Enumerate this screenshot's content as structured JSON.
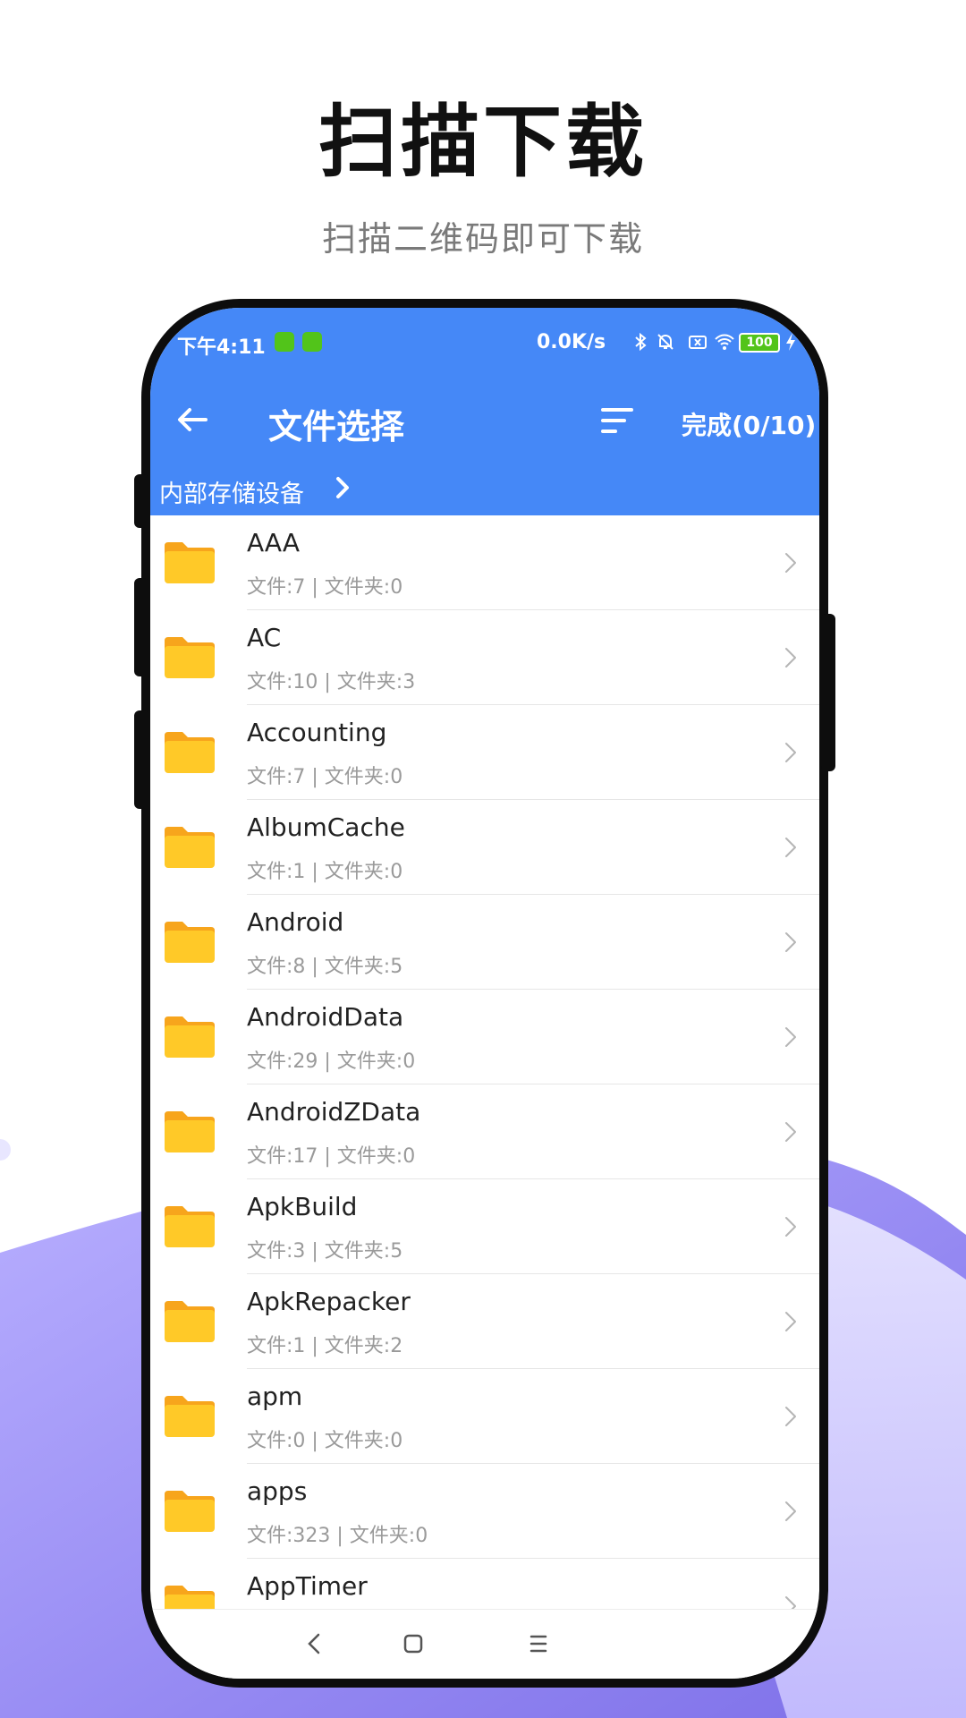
{
  "headline": "扫描下载",
  "subline": "扫描二维码即可下载",
  "status_bar": {
    "time": "下午4:11",
    "net_speed": "0.0K/s",
    "battery": "100"
  },
  "toolbar": {
    "title": "文件选择",
    "done_label": "完成(0/10)"
  },
  "breadcrumb": {
    "label": "内部存储设备"
  },
  "folders": [
    {
      "name": "AAA",
      "meta": "文件:7 | 文件夹:0"
    },
    {
      "name": "AC",
      "meta": "文件:10 | 文件夹:3"
    },
    {
      "name": "Accounting",
      "meta": "文件:7 | 文件夹:0"
    },
    {
      "name": "AlbumCache",
      "meta": "文件:1 | 文件夹:0"
    },
    {
      "name": "Android",
      "meta": "文件:8 | 文件夹:5"
    },
    {
      "name": "AndroidData",
      "meta": "文件:29 | 文件夹:0"
    },
    {
      "name": "AndroidZData",
      "meta": "文件:17 | 文件夹:0"
    },
    {
      "name": "ApkBuild",
      "meta": "文件:3 | 文件夹:5"
    },
    {
      "name": "ApkRepacker",
      "meta": "文件:1 | 文件夹:2"
    },
    {
      "name": "apm",
      "meta": "文件:0 | 文件夹:0"
    },
    {
      "name": "apps",
      "meta": "文件:323 | 文件夹:0"
    },
    {
      "name": "AppTimer",
      "meta": ""
    }
  ],
  "colors": {
    "header": "#4588f7",
    "folder": "#ffc928",
    "folder_tab": "#f7a51c",
    "wave": "#8c7ff0"
  },
  "icons": {
    "back": "arrow-left-icon",
    "sort": "sort-icon",
    "chevron": "chevron-right-icon",
    "folder": "folder-icon",
    "nav_back": "nav-back-icon",
    "nav_home": "nav-home-icon",
    "nav_menu": "nav-menu-icon"
  }
}
